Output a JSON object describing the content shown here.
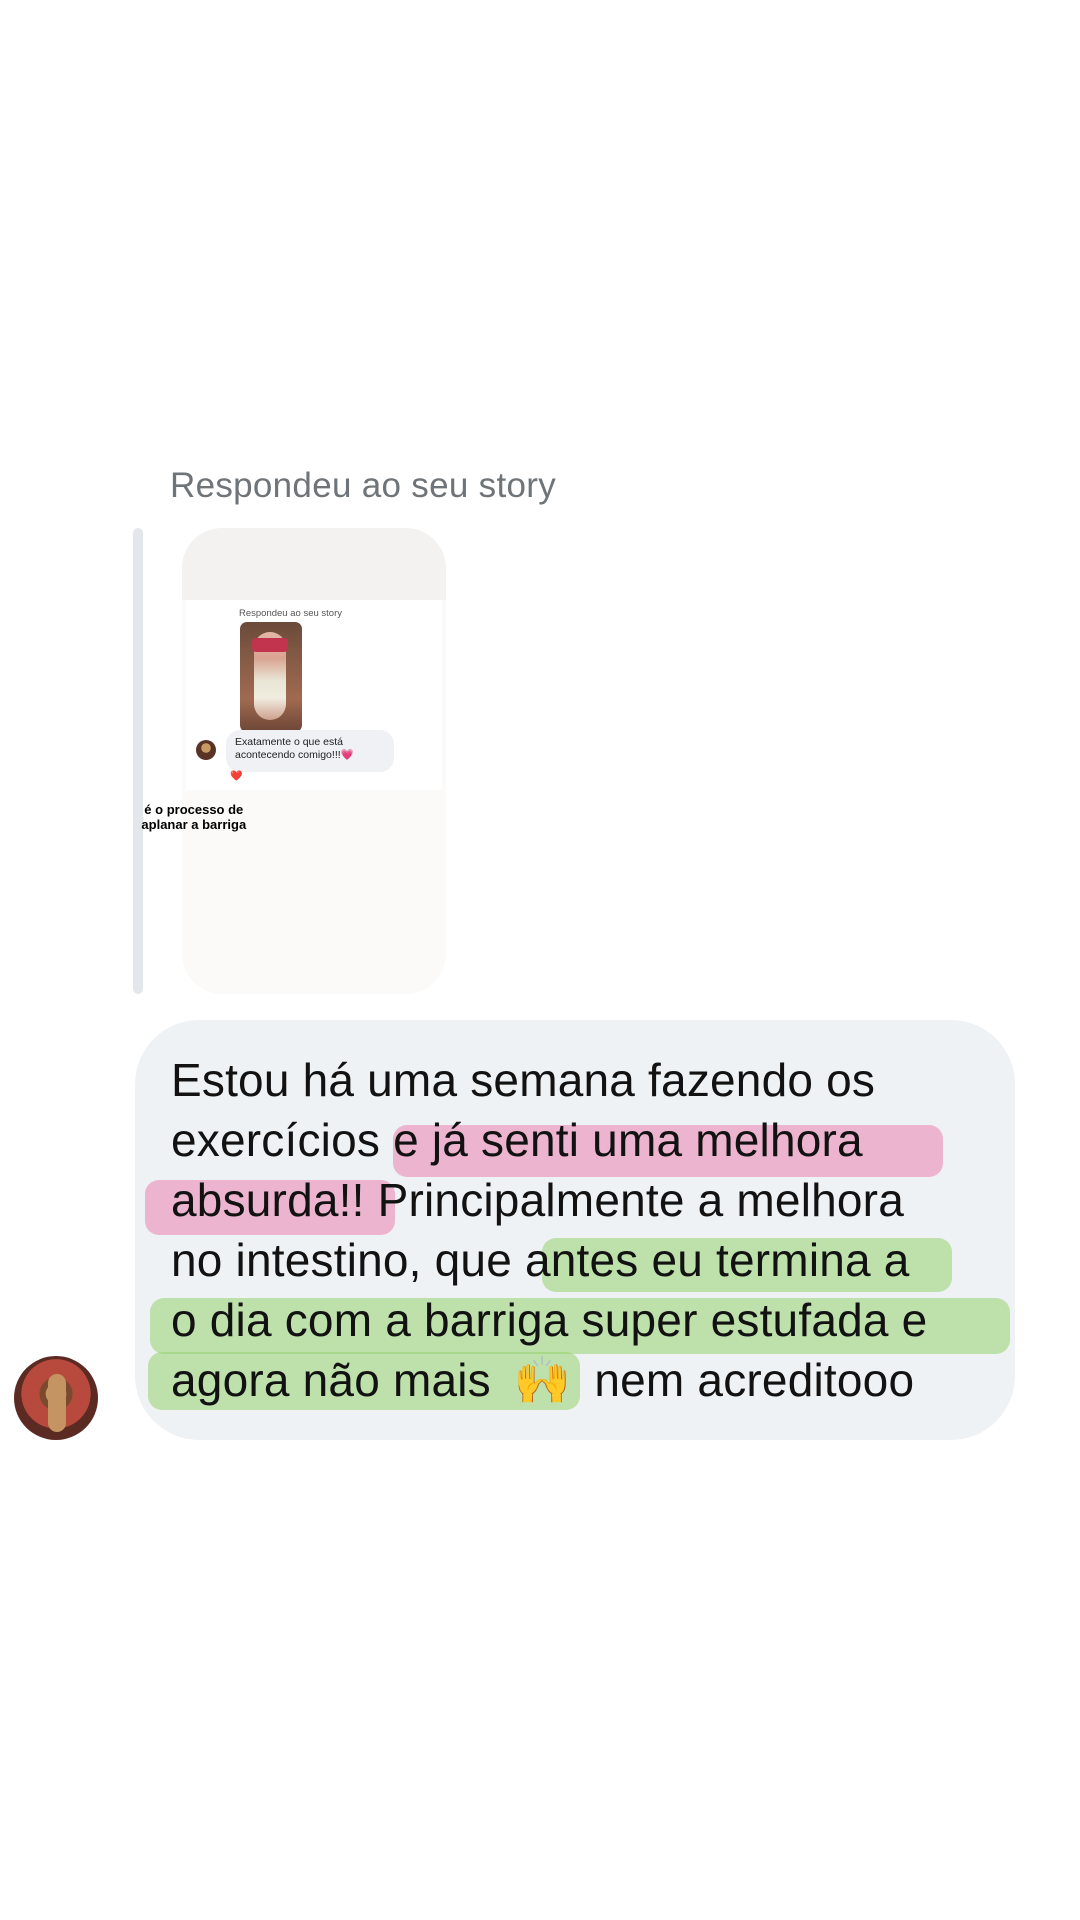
{
  "reply": {
    "caption": "Respondeu ao seu story"
  },
  "story_preview": {
    "caption": "Respondeu ao seu story",
    "message": "Exatamente o que está acontecendo comigo!!!💗",
    "reaction": "❤️",
    "overlay_line1": "é o processo de",
    "overlay_line2": "aplanar  a barriga"
  },
  "message": {
    "line1": "Estou há uma semana fazendo os",
    "line2a": "exercícios ",
    "line2b": "e já senti uma melhora",
    "line3a": "absurda!!",
    "line3b": " Principalmente a melhora",
    "line4a": "no intestino, que ",
    "line4b": "antes eu termina a",
    "line5": "o dia com a barriga super estufada e",
    "line6a": "agora não mais",
    "line6_emoji": "🙌",
    "line6b": "nem acreditooo"
  },
  "colors": {
    "highlight_pink": "#e982ad",
    "highlight_green": "#96d26e",
    "bubble": "#eff2f5"
  }
}
